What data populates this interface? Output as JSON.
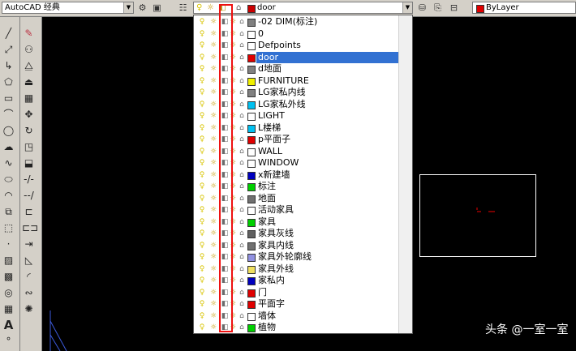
{
  "toolbar": {
    "workspace": "AutoCAD 经典",
    "current_layer": "door",
    "current_layer_color": "#cc0000",
    "color_control": "ByLayer",
    "color_control_swatch": "#e00000"
  },
  "layers": [
    {
      "name": "-02 DIM(标注)",
      "color": "#808080"
    },
    {
      "name": "0",
      "color": "#ffffff"
    },
    {
      "name": "Defpoints",
      "color": "#ffffff"
    },
    {
      "name": "door",
      "color": "#e00000",
      "selected": true
    },
    {
      "name": "d地面",
      "color": "#808080"
    },
    {
      "name": "FURNITURE",
      "color": "#f0f000"
    },
    {
      "name": "LG家私内线",
      "color": "#808080"
    },
    {
      "name": "LG家私外线",
      "color": "#00c0f0"
    },
    {
      "name": "LIGHT",
      "color": "#ffffff"
    },
    {
      "name": "L楼梯",
      "color": "#00c0f0"
    },
    {
      "name": "p平面子",
      "color": "#e00000"
    },
    {
      "name": "WALL",
      "color": "#ffffff"
    },
    {
      "name": "WINDOW",
      "color": "#ffffff"
    },
    {
      "name": "x新建墙",
      "color": "#0000c0"
    },
    {
      "name": "标注",
      "color": "#00d000"
    },
    {
      "name": "地面",
      "color": "#707070"
    },
    {
      "name": "活动家具",
      "color": "#ffffff"
    },
    {
      "name": "家具",
      "color": "#00d000"
    },
    {
      "name": "家具灰线",
      "color": "#606060"
    },
    {
      "name": "家具内线",
      "color": "#707070"
    },
    {
      "name": "家具外轮廓线",
      "color": "#9090e0"
    },
    {
      "name": "家具外线",
      "color": "#f0e060"
    },
    {
      "name": "家私内",
      "color": "#0000c0"
    },
    {
      "name": "门",
      "color": "#e00000"
    },
    {
      "name": "平面字",
      "color": "#e00000"
    },
    {
      "name": "墙体",
      "color": "#ffffff"
    },
    {
      "name": "植物",
      "color": "#00d000"
    }
  ],
  "icons": {
    "on_off": "bulb-icon",
    "freeze": "sun-icon",
    "viewport_freeze": "viewport-freeze-icon",
    "lock": "lock-icon"
  },
  "watermark": "头条 @一室一室"
}
